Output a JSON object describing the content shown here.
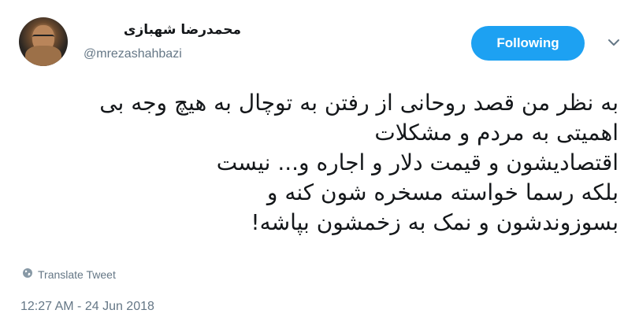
{
  "author": {
    "name": "محمدرضا شهبازی",
    "handle": "@mrezashahbazi"
  },
  "follow_button": {
    "label": "Following",
    "color": "#1da1f2"
  },
  "menu": {
    "icon": "chevron-down-icon"
  },
  "tweet": {
    "lines": [
      "به نظر من قصد روحانی از رفتن به توچال به هیچ وجه بی",
      "اهمیتی به مردم و مشکلات",
      "اقتصادیشون و قیمت دلار و اجاره و... نیست",
      "بلکه رسما خواسته مسخره شون کنه و",
      "بسوزوندشون و نمک به زخمشون بپاشه!"
    ]
  },
  "translate": {
    "label": "Translate Tweet",
    "icon": "globe-icon"
  },
  "timestamp": "12:27 AM - 24 Jun 2018",
  "colors": {
    "text": "#14171a",
    "secondary": "#657786",
    "accent": "#1da1f2"
  }
}
